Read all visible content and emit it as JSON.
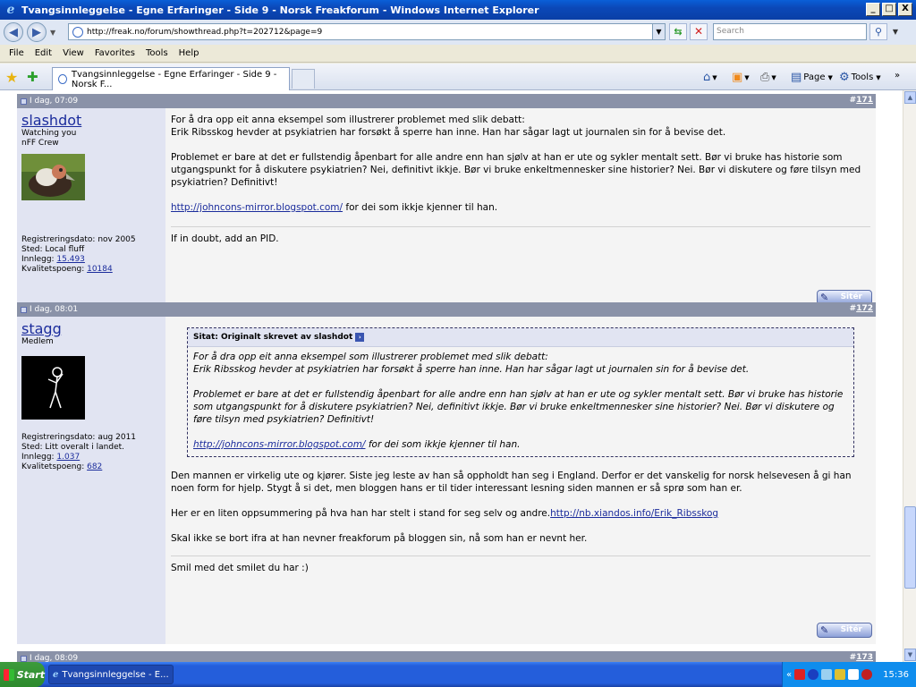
{
  "window": {
    "title": "Tvangsinnleggelse - Egne Erfaringer - Side 9 - Norsk Freakforum - Windows Internet Explorer",
    "minimize": "_",
    "maximize": "□",
    "close": "X"
  },
  "address": {
    "url": "http://freak.no/forum/showthread.php?t=202712&page=9",
    "search_placeholder": "Search"
  },
  "menu": [
    "File",
    "Edit",
    "View",
    "Favorites",
    "Tools",
    "Help"
  ],
  "tab": {
    "title": "Tvangsinnleggelse - Egne Erfaringer - Side 9 - Norsk F..."
  },
  "commands": {
    "page": "Page",
    "tools": "Tools"
  },
  "posts": [
    {
      "date": "I dag, 07:09",
      "number": "#171",
      "number_prefix": "#",
      "number_link": "171",
      "username": "slashdot",
      "title1": "Watching you",
      "title2": "nFF Crew",
      "reg": "Registreringsdato: nov 2005",
      "place": "Sted: Local fluff",
      "posts_label": "Innlegg: ",
      "posts_count": "15.493",
      "quality_label": "Kvalitetspoeng: ",
      "quality": "10184",
      "p1a": "For å dra opp eit anna eksempel som illustrerer problemet med slik debatt:",
      "p1b": "Erik Ribsskog hevder at psykiatrien har forsøkt å sperre han inne. Han har sågar lagt ut journalen sin for å bevise det.",
      "p2": "Problemet er bare at det er fullstendig åpenbart for alle andre enn han sjølv at han er ute og sykler mentalt sett. Bør vi bruke has historie som utgangspunkt for å diskutere psykiatrien? Nei, definitivt ikkje. Bør vi bruke enkeltmennesker sine historier? Nei. Bør vi diskutere og føre tilsyn med psykiatrien? Definitivt!",
      "link": "http://johncons-mirror.blogspot.com/",
      "link_after": " for dei som ikkje kjenner til han.",
      "signature": "If in doubt, add an PID.",
      "quote_btn": "Sitér"
    },
    {
      "date": "I dag, 08:01",
      "number_prefix": "#",
      "number_link": "172",
      "username": "stagg",
      "title1": "Medlem",
      "reg": "Registreringsdato: aug 2011",
      "place": "Sted: Litt overalt i landet.",
      "posts_label": "Innlegg: ",
      "posts_count": "1.037",
      "quality_label": "Kvalitetspoeng: ",
      "quality": "682",
      "quote_title": "Sitat: Originalt skrevet av slashdot",
      "q1a": "For å dra opp eit anna eksempel som illustrerer problemet med slik debatt:",
      "q1b": "Erik Ribsskog hevder at psykiatrien har forsøkt å sperre han inne. Han har sågar lagt ut journalen sin for å bevise det.",
      "q2": "Problemet er bare at det er fullstendig åpenbart for alle andre enn han sjølv at han er ute og sykler mentalt sett. Bør vi bruke has historie som utgangspunkt for å diskutere psykiatrien? Nei, definitivt ikkje. Bør vi bruke enkeltmennesker sine historier? Nei. Bør vi diskutere og føre tilsyn med psykiatrien? Definitivt!",
      "q_link": "http://johncons-mirror.blogspot.com/",
      "q_link_after": " for dei som ikkje kjenner til han.",
      "p1": "Den mannen er virkelig ute og kjører. Siste jeg leste av han så oppholdt han seg i England. Derfor er det vanskelig for norsk helsevesen å gi han noen form for hjelp. Stygt å si det, men bloggen hans er til tider interessant lesning siden mannen er så sprø som han er.",
      "p2_text": "Her er en liten oppsummering på hva han har stelt i stand for seg selv og andre.",
      "p2_link": "http://nb.xiandos.info/Erik_Ribsskog",
      "p3": "Skal ikke se bort ifra at han nevner freakforum på bloggen sin, nå som han er nevnt her.",
      "signature": "Smil med det smilet du har :)",
      "quote_btn": "Sitér"
    },
    {
      "date": "I dag, 08:09",
      "number_prefix": "#",
      "number_link": "173"
    }
  ],
  "taskbar": {
    "start": "Start",
    "task": "Tvangsinnleggelse - E...",
    "clock": "15:36"
  }
}
